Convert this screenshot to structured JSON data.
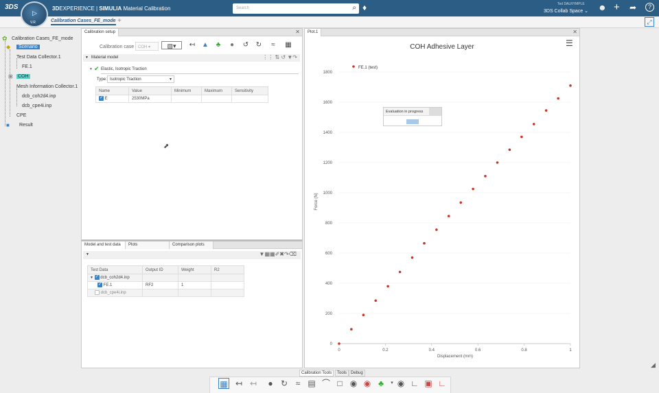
{
  "brand": {
    "ds_logo": "3DS",
    "experience_prefix": "3D",
    "experience": "EXPERIENCE",
    "separator": " | ",
    "simulia": "SIMULIA",
    "app": "Material Calibration",
    "compass_version": "V.R"
  },
  "search": {
    "placeholder": "Search"
  },
  "user": {
    "name": "Ted DALRYMPLE",
    "space": "3DS Collab Space"
  },
  "tabs": {
    "active": "Calibration Cases_FE_mode",
    "add": "+"
  },
  "tree": {
    "root": "Calibration Cases_FE_mode",
    "scenario": "Scenario",
    "test_collector": "Test Data Collector.1",
    "fe1": "FE.1",
    "coh": "COH",
    "mesh_collector": "Mesh Information Collector.1",
    "mesh1": "dcb_coh2d4.inp",
    "mesh2": "dcb_cpe4i.inp",
    "cpe": "CPE",
    "result": "Result"
  },
  "setup": {
    "tab": "Calibration setup",
    "case_label": "Calibration case",
    "case_value": "COH",
    "section": "Material model",
    "model": "Elastic, Isotropic Traction",
    "type_label": "Type:",
    "type_value": "Isotropic Traction",
    "columns": [
      "Name",
      "Value",
      "Minimum",
      "Maximum",
      "Sensitivity"
    ],
    "row": {
      "name": "E",
      "value": "2530MPa"
    }
  },
  "lower": {
    "tabs": [
      "Model and test data",
      "Plots",
      "Comparison plots"
    ],
    "columns": [
      "Test Data",
      "Output ID",
      "Weight",
      "R2"
    ],
    "rows": [
      {
        "name": "dcb_coh2d4.inp",
        "output": "",
        "weight": ""
      },
      {
        "name": "FE.1",
        "output": "RF2",
        "weight": "1"
      },
      {
        "name": "dcb_cpe4i.inp",
        "output": "",
        "weight": ""
      }
    ]
  },
  "plot": {
    "tab": "Plot.1",
    "progress_text": "Evaluation in progress"
  },
  "bottom_tabs": [
    "Calibration Tools",
    "Tools",
    "Debug"
  ],
  "colors": {
    "topbar": "#2c5d85",
    "accent": "#3b82c4",
    "point": "#c0392b",
    "highlight": "#59d1c4"
  },
  "chart_data": {
    "type": "scatter",
    "title": "COH Adhesive Layer",
    "xlabel": "Displacement (mm)",
    "ylabel": "Force (N)",
    "xlim": [
      0,
      1
    ],
    "ylim": [
      0,
      1800
    ],
    "xticks": [
      "0",
      "0.2",
      "0.4",
      "0.6",
      "0.8",
      "1"
    ],
    "yticks": [
      "0",
      "200",
      "400",
      "600",
      "800",
      "1000",
      "1200",
      "1400",
      "1600",
      "1800"
    ],
    "legend": "top-left",
    "series": [
      {
        "name": "FE.1 (test)",
        "x": [
          0,
          0.053,
          0.105,
          0.158,
          0.211,
          0.263,
          0.316,
          0.368,
          0.421,
          0.474,
          0.526,
          0.579,
          0.632,
          0.684,
          0.737,
          0.789,
          0.842,
          0.895,
          0.947,
          1.0
        ],
        "y": [
          0,
          95,
          190,
          285,
          380,
          475,
          570,
          665,
          755,
          845,
          935,
          1025,
          1110,
          1200,
          1285,
          1370,
          1455,
          1545,
          1625,
          1710
        ]
      }
    ]
  }
}
